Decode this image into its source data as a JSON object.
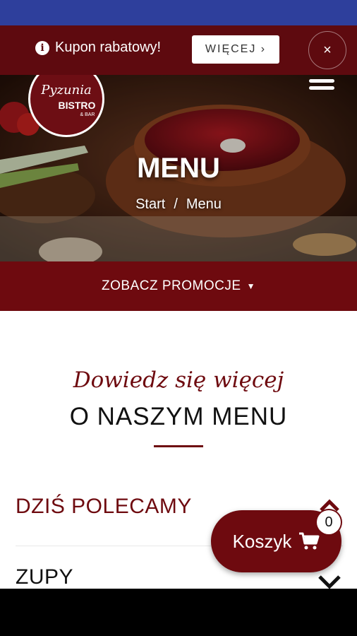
{
  "coupon_bar": {
    "text": "Kupon rabatowy!",
    "more_label": "WIĘCEJ ›",
    "close_label": "×"
  },
  "brand": {
    "logo_line1": "Pyzunia",
    "logo_line2": "BISTRO",
    "logo_line3": "& BAR"
  },
  "hero": {
    "title": "MENU",
    "breadcrumb": {
      "start": "Start",
      "separator": "/",
      "current": "Menu"
    }
  },
  "promo": {
    "label": "ZOBACZ PROMOCJE"
  },
  "intro": {
    "script_line": "Dowiedz się więcej",
    "heading": "O NASZYM MENU"
  },
  "menu_sections": [
    {
      "label": "DZIŚ POLECAMY"
    },
    {
      "label": "ZUPY"
    }
  ],
  "cart": {
    "label": "Koszyk",
    "count": "0"
  },
  "colors": {
    "status_bar": "#2e3f9c",
    "brand_dark": "#5e0a0f",
    "brand": "#6e0a0f"
  }
}
